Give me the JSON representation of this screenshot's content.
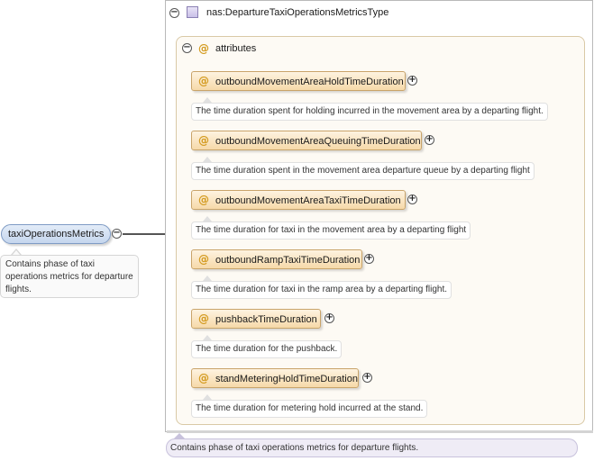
{
  "element": {
    "name": "taxiOperationsMetrics",
    "annotation": "Contains phase of taxi operations metrics for departure flights."
  },
  "type": {
    "name": "nas:DepartureTaxiOperationsMetricsType",
    "annotation": "Contains phase of taxi operations metrics for departure flights."
  },
  "attributes": {
    "label": "attributes",
    "items": [
      {
        "name": "outboundMovementAreaHoldTimeDuration",
        "doc": "The time duration spent for holding incurred in the movement area by a departing flight."
      },
      {
        "name": "outboundMovementAreaQueuingTimeDuration",
        "doc": "The time duration spent in the movement area departure queue by a departing flight"
      },
      {
        "name": "outboundMovementAreaTaxiTimeDuration",
        "doc": "The time duration for taxi in the movement area by a departing flight"
      },
      {
        "name": "outboundRampTaxiTimeDuration",
        "doc": "The time duration for taxi in the ramp area by a departing flight."
      },
      {
        "name": "pushbackTimeDuration",
        "doc": "The time duration for the pushback."
      },
      {
        "name": "standMeteringHoldTimeDuration",
        "doc": "The time duration for metering hold incurred at the stand."
      }
    ]
  },
  "icons": {
    "collapse": "−",
    "expand": "+",
    "attribute": "@"
  },
  "colors": {
    "element_node": "#c5d6ee",
    "attribute_node": "#f6d9a9",
    "attribute_icon": "#d39a1e",
    "type_annotation": "#efecf6"
  }
}
